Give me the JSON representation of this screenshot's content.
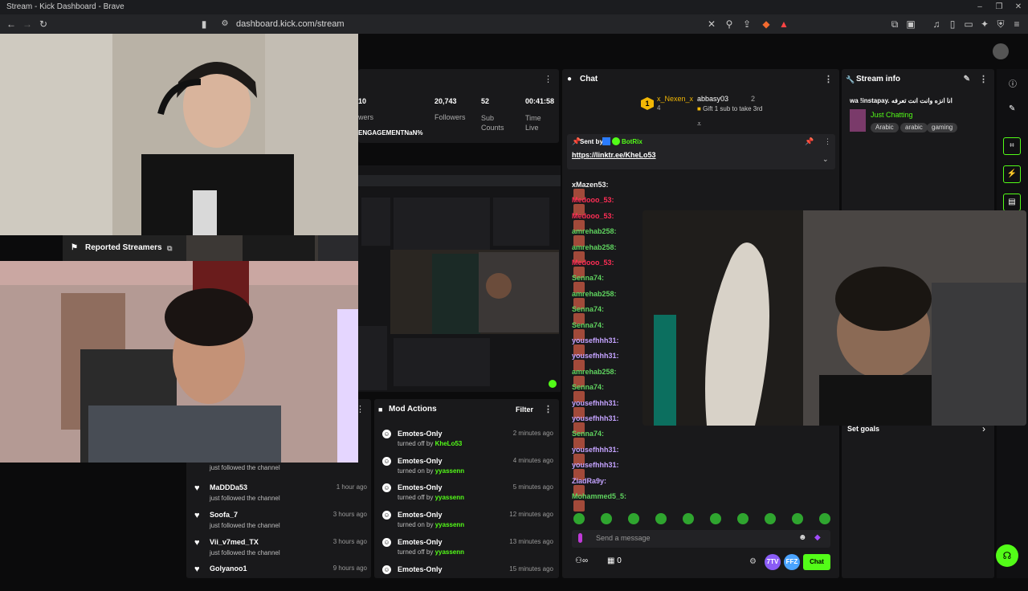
{
  "window": {
    "title": "Stream - Kick Dashboard - Brave"
  },
  "browser": {
    "url": "dashboard.kick.com/stream"
  },
  "stats": [
    {
      "value": "10",
      "label": "wers"
    },
    {
      "value": "20,743",
      "label": "Followers"
    },
    {
      "value": "52",
      "label": "Sub Counts"
    },
    {
      "value": "00:41:58",
      "label": "Time Live"
    }
  ],
  "engagement": {
    "label": "ENGAGEMENT",
    "value": "NaN%"
  },
  "chat": {
    "title": "Chat",
    "top_gifters": [
      {
        "rank": "1",
        "name": "x_Nexen_x",
        "count": "4"
      },
      {
        "name": "abbasy03",
        "count": "2"
      }
    ],
    "gift_hint": "Gift 1 sub to take 3rd",
    "pinned": {
      "sent_by_label": "Sent by",
      "sender": "BotRix",
      "link": "https://linktr.ee/KheLo53"
    },
    "messages": [
      {
        "user": "xMazen53:",
        "color": "#f0f0f0"
      },
      {
        "user": "Medooo_53:",
        "color": "#ff2d55"
      },
      {
        "user": "Medooo_53:",
        "color": "#ff2d55"
      },
      {
        "user": "amrehab258:",
        "color": "#5fd35f"
      },
      {
        "user": "amrehab258:",
        "color": "#5fd35f"
      },
      {
        "user": "Medooo_53:",
        "color": "#ff2d55"
      },
      {
        "user": "Senna74:",
        "color": "#5fd35f"
      },
      {
        "user": "amrehab258:",
        "color": "#5fd35f"
      },
      {
        "user": "Senna74:",
        "color": "#5fd35f"
      },
      {
        "user": "Senna74:",
        "color": "#5fd35f"
      },
      {
        "user": "yousefhhh31:",
        "color": "#c4a3ff"
      },
      {
        "user": "yousefhhh31:",
        "color": "#c4a3ff"
      },
      {
        "user": "amrehab258:",
        "color": "#5fd35f"
      },
      {
        "user": "Senna74:",
        "color": "#5fd35f"
      },
      {
        "user": "yousefhhh31:",
        "color": "#c4a3ff"
      },
      {
        "user": "yousefhhh31:",
        "color": "#c4a3ff"
      },
      {
        "user": "Senna74:",
        "color": "#5fd35f"
      },
      {
        "user": "yousefhhh31:",
        "color": "#c4a3ff"
      },
      {
        "user": "yousefhhh31:",
        "color": "#c4a3ff"
      },
      {
        "user": "ZiadRa9y:",
        "color": "#c4a3ff"
      },
      {
        "user": "Mohammed5_5:",
        "color": "#5fd35f"
      }
    ],
    "input_placeholder": "Send a message",
    "viewer_count": "0",
    "send_label": "Chat",
    "badge_7tv": "7TV",
    "badge_ffz": "FFZ"
  },
  "stream_info": {
    "title": "Stream info",
    "stream_title": "wa !instapay. انا انزه وانت انت تعرفه",
    "category": "Just Chatting",
    "tags": [
      "Arabic",
      "arabic",
      "gaming"
    ],
    "set_goals": "Set goals"
  },
  "reported": {
    "title": "Reported Streamers"
  },
  "follows": [
    {
      "name": "",
      "sub": "just followed the channel",
      "time": ""
    },
    {
      "name": "MaDDDa53",
      "sub": "just followed the channel",
      "time": "1 hour ago"
    },
    {
      "name": "Soofa_7",
      "sub": "just followed the channel",
      "time": "3 hours ago"
    },
    {
      "name": "Vii_v7med_TX",
      "sub": "just followed the channel",
      "time": "3 hours ago"
    },
    {
      "name": "Golyanoo1",
      "sub": "",
      "time": "9 hours ago"
    }
  ],
  "mod_actions": {
    "title": "Mod Actions",
    "filter": "Filter",
    "items": [
      {
        "name": "Emotes-Only",
        "action": "turned off by",
        "by": "KheLo53",
        "time": "2 minutes ago"
      },
      {
        "name": "Emotes-Only",
        "action": "turned on by",
        "by": "yyassenn",
        "time": "4 minutes ago"
      },
      {
        "name": "Emotes-Only",
        "action": "turned off by",
        "by": "yyassenn",
        "time": "5 minutes ago"
      },
      {
        "name": "Emotes-Only",
        "action": "turned on by",
        "by": "yyassenn",
        "time": "12 minutes ago"
      },
      {
        "name": "Emotes-Only",
        "action": "turned off by",
        "by": "yyassenn",
        "time": "13 minutes ago"
      },
      {
        "name": "Emotes-Only",
        "action": "",
        "by": "",
        "time": "15 minutes ago"
      }
    ]
  }
}
